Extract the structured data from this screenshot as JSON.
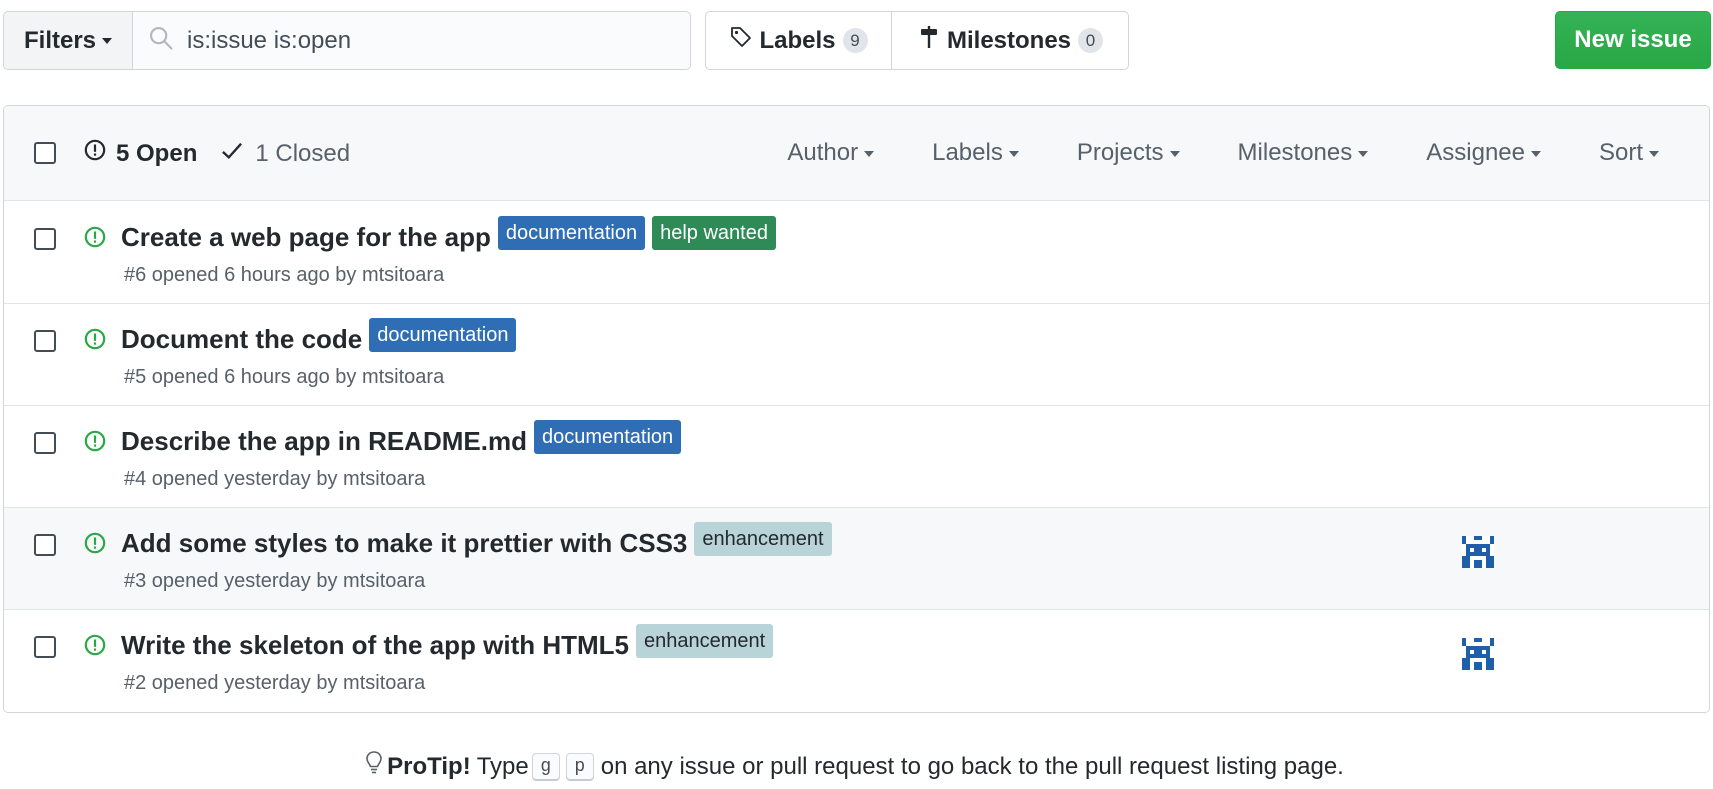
{
  "toolbar": {
    "filters_label": "Filters",
    "search_value": "is:issue is:open",
    "labels_label": "Labels",
    "labels_count": "9",
    "milestones_label": "Milestones",
    "milestones_count": "0",
    "new_issue_label": "New issue"
  },
  "header": {
    "open_label": "5 Open",
    "closed_label": "1 Closed",
    "filters": [
      "Author",
      "Labels",
      "Projects",
      "Milestones",
      "Assignee",
      "Sort"
    ]
  },
  "issues": [
    {
      "title": "Create a web page for the app",
      "meta": "#6 opened 6 hours ago by mtsitoara",
      "labels": [
        {
          "name": "documentation",
          "bg": "#2f6eb5",
          "fg": "#ffffff"
        },
        {
          "name": "help wanted",
          "bg": "#2e8b57",
          "fg": "#ffffff"
        }
      ],
      "has_assignee": false
    },
    {
      "title": "Document the code",
      "meta": "#5 opened 6 hours ago by mtsitoara",
      "labels": [
        {
          "name": "documentation",
          "bg": "#2f6eb5",
          "fg": "#ffffff"
        }
      ],
      "has_assignee": false
    },
    {
      "title": "Describe the app in README.md",
      "meta": "#4 opened yesterday by mtsitoara",
      "labels": [
        {
          "name": "documentation",
          "bg": "#2f6eb5",
          "fg": "#ffffff"
        }
      ],
      "has_assignee": false
    },
    {
      "title": "Add some styles to make it prettier with CSS3",
      "meta": "#3 opened yesterday by mtsitoara",
      "labels": [
        {
          "name": "enhancement",
          "bg": "#b8d4d8",
          "fg": "#24292e"
        }
      ],
      "has_assignee": true
    },
    {
      "title": "Write the skeleton of the app with HTML5",
      "meta": "#2 opened yesterday by mtsitoara",
      "labels": [
        {
          "name": "enhancement",
          "bg": "#b8d4d8",
          "fg": "#24292e"
        }
      ],
      "has_assignee": true
    }
  ],
  "protip": {
    "strong": "ProTip!",
    "before": "Type",
    "key1": "g",
    "key2": "p",
    "after": "on any issue or pull request to go back to the pull request listing page."
  },
  "colors": {
    "primary_green": "#2ea44f",
    "open_icon": "#28a745",
    "label_documentation": "#2f6eb5",
    "label_help_wanted": "#2e8b57",
    "label_enhancement": "#b8d4d8"
  }
}
